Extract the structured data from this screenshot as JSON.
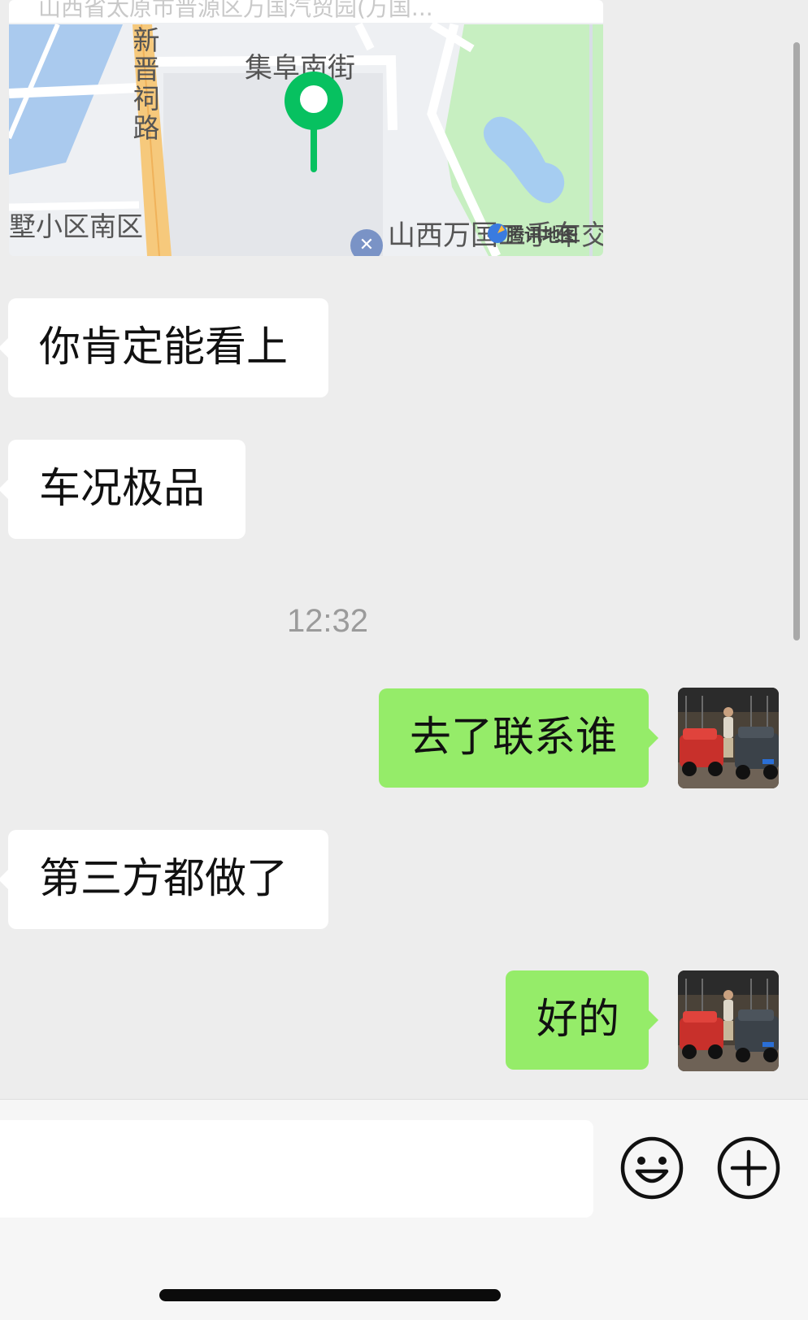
{
  "map": {
    "title": "山西省太原市晋源区万国汽贸园(万国...",
    "street_label": "集阜南街",
    "road_label": "新晋祠路",
    "district_label": "墅小区南区",
    "market_label": "山西万国二手车交易市场",
    "brand_label": "腾讯地图"
  },
  "messages": [
    {
      "side": "in",
      "text": "你肯定能看上"
    },
    {
      "side": "in",
      "text": "车况极品"
    },
    {
      "side": "out",
      "text": "去了联系谁"
    },
    {
      "side": "in",
      "text": "第三方都做了"
    },
    {
      "side": "out",
      "text": "好的"
    }
  ],
  "timestamp": "12:32",
  "input": {
    "value": "",
    "placeholder": ""
  },
  "icons": {
    "emoji": "smiley-face-icon",
    "plus": "plus-circle-icon",
    "pin": "location-pin-icon",
    "service": "wrench-service-icon",
    "brand": "tencent-map-logo-icon"
  },
  "colors": {
    "incoming_bubble": "#ffffff",
    "outgoing_bubble": "#95ec69",
    "pin_green": "#07c160",
    "background": "#ededed"
  }
}
